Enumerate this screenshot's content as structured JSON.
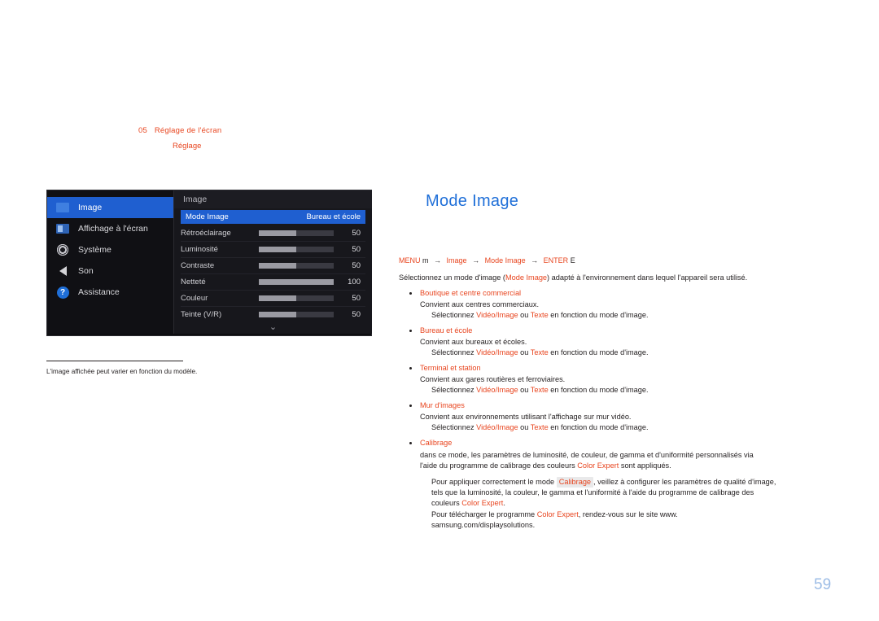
{
  "chapter": {
    "number": "05",
    "title": "Réglage de l'écran",
    "subtitle": "Réglage"
  },
  "osd": {
    "left_items": [
      {
        "label": "Image",
        "icon": "picture-icon",
        "selected": true
      },
      {
        "label": "Affichage à l'écran",
        "icon": "osd-icon",
        "selected": false
      },
      {
        "label": "Système",
        "icon": "gear-icon",
        "selected": false
      },
      {
        "label": "Son",
        "icon": "speaker-icon",
        "selected": false
      },
      {
        "label": "Assistance",
        "icon": "help-icon",
        "selected": false
      }
    ],
    "panel_title": "Image",
    "mode_row": {
      "label": "Mode Image",
      "value": "Bureau et école"
    },
    "items": [
      {
        "label": "Rétroéclairage",
        "value": "50",
        "fill": 50
      },
      {
        "label": "Luminosité",
        "value": "50",
        "fill": 50
      },
      {
        "label": "Contraste",
        "value": "50",
        "fill": 50
      },
      {
        "label": "Netteté",
        "value": "100",
        "fill": 100
      },
      {
        "label": "Couleur",
        "value": "50",
        "fill": 50
      },
      {
        "label": "Teinte (V/R)",
        "value": "50",
        "fill": 50
      }
    ],
    "more_icon": "chevron-down-icon"
  },
  "caption": "L'image affichée peut varier en fonction du modèle.",
  "main": {
    "heading": "Mode Image",
    "path": {
      "menu": "MENU",
      "arrow1": "→",
      "m": "m",
      "arrow2": "→",
      "image": "Image",
      "arrow3": "→",
      "mode_image": "Mode Image",
      "arrow4": "→",
      "enter": "ENTER",
      "e": "E"
    },
    "intro_pre": "Sélectionnez un mode d'image (",
    "intro_red": "Mode Image",
    "intro_post": ") adapté à l'environnement dans lequel l'appareil sera utilisé.",
    "modes": [
      {
        "name": "Boutique et centre commercial",
        "desc": "Convient aux centres commerciaux.",
        "sub_pre": "Sélectionnez ",
        "sub_r1": "Vidéo/Image",
        "sub_mid": " ou ",
        "sub_r2": "Texte",
        "sub_post": " en fonction du mode d'image."
      },
      {
        "name": "Bureau et école",
        "desc": "Convient aux bureaux et écoles.",
        "sub_pre": "Sélectionnez ",
        "sub_r1": "Vidéo/Image",
        "sub_mid": " ou ",
        "sub_r2": "Texte",
        "sub_post": " en fonction du mode d'image."
      },
      {
        "name": "Terminal et station",
        "desc": "Convient aux gares routières et ferroviaires.",
        "sub_pre": "Sélectionnez ",
        "sub_r1": "Vidéo/Image",
        "sub_mid": " ou ",
        "sub_r2": "Texte",
        "sub_post": " en fonction du mode d'image."
      },
      {
        "name": "Mur d'images",
        "desc": "Convient aux environnements utilisant l'affichage sur mur vidéo.",
        "sub_pre": "Sélectionnez ",
        "sub_r1": "Vidéo/Image",
        "sub_mid": " ou ",
        "sub_r2": "Texte",
        "sub_post": " en fonction du mode d'image."
      }
    ],
    "calibration": {
      "name": "Calibrage",
      "line1_pre": "dans ce mode, les paramètres de luminosité, de couleur, de gamma et d'uniformité personnalisés via",
      "line2_pre": "l'aide du programme de calibrage des couleurs ",
      "line2_red": "Color Expert",
      "line2_post": " sont appliqués.",
      "note1_pre": "Pour appliquer correctement le mode ",
      "note1_red": "Calibrage",
      "note1_post": ", veillez à configurer les paramètres de qualité d'image,",
      "note2": "tels que la luminosité, la couleur, le gamma et l'uniformité à l'aide du programme de calibrage des",
      "note3_pre": "couleurs ",
      "note3_red": "Color Expert",
      "note3_post": ".",
      "note4_pre": "Pour télécharger le programme ",
      "note4_red": "Color Expert",
      "note4_post": ", rendez-vous sur le site www.",
      "note5": "samsung.com/displaysolutions."
    }
  },
  "page_number": "59"
}
